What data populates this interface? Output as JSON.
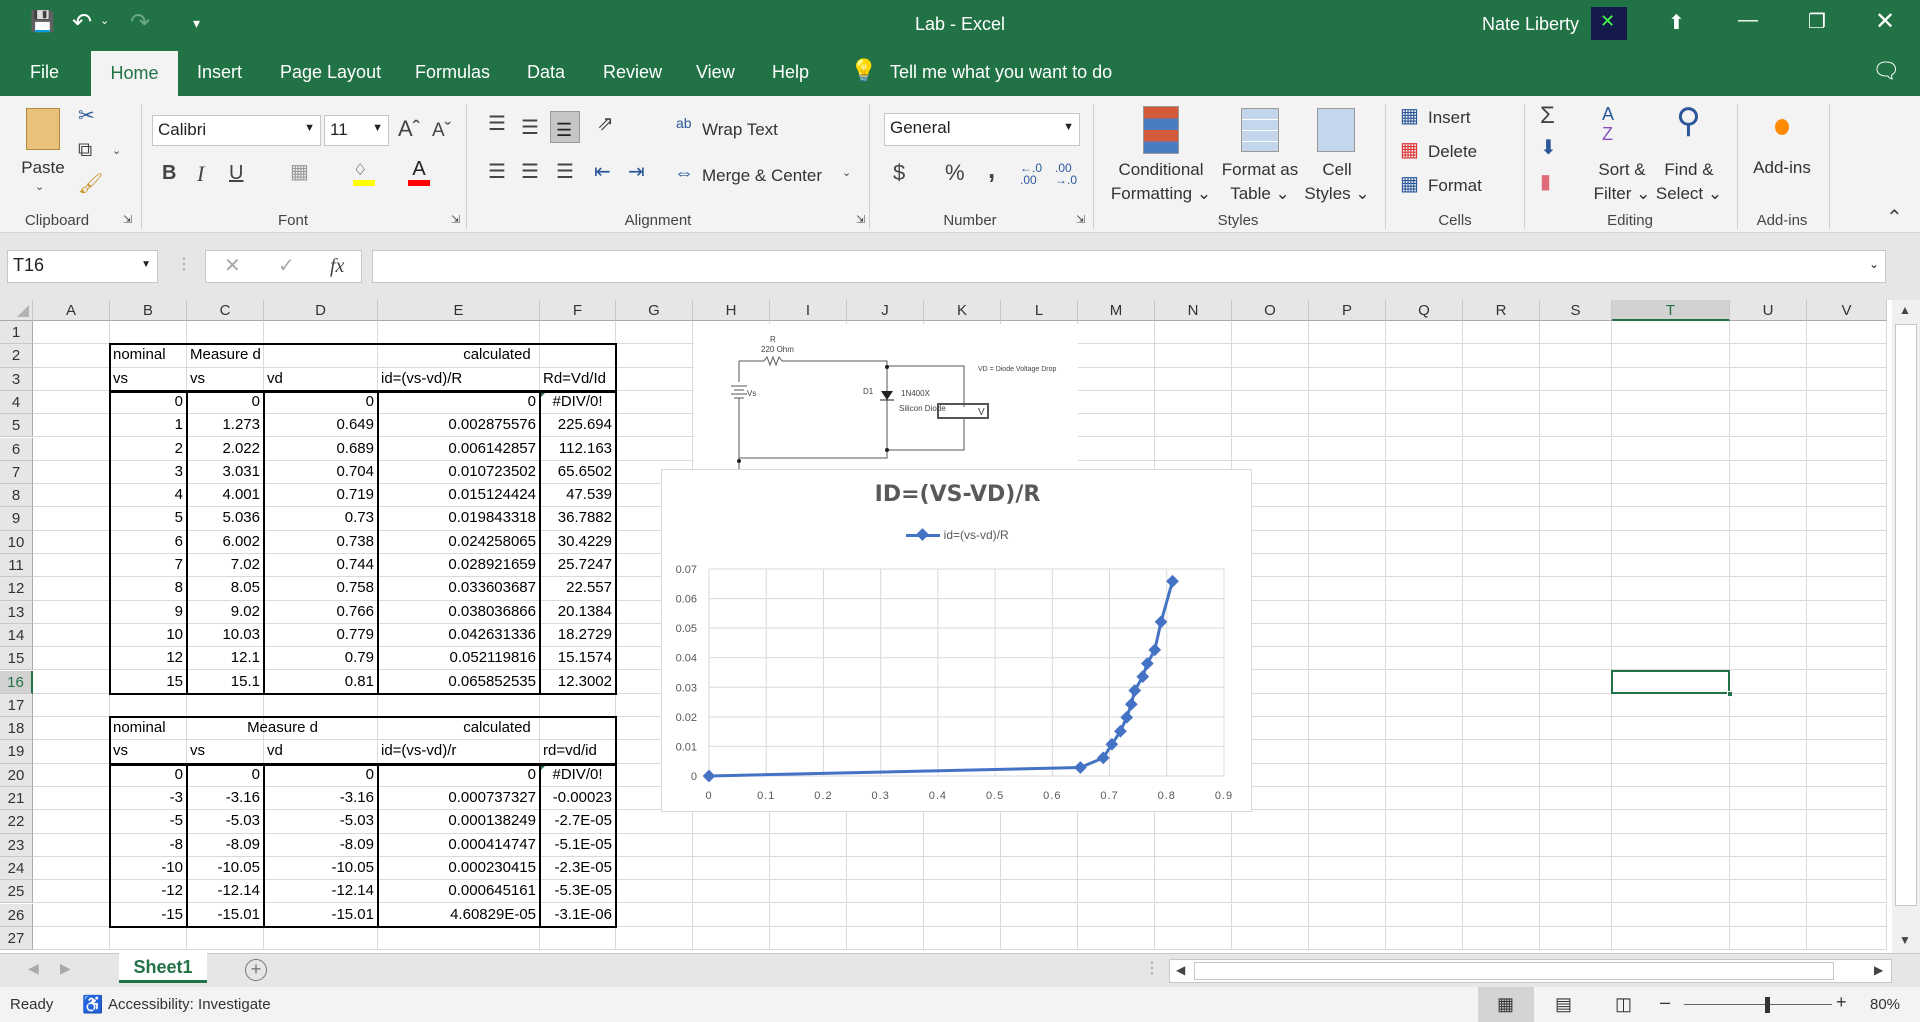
{
  "titlebar": {
    "title": "Lab  -  Excel",
    "user": "Nate Liberty"
  },
  "tabs": [
    "File",
    "Home",
    "Insert",
    "Page Layout",
    "Formulas",
    "Data",
    "Review",
    "View",
    "Help"
  ],
  "tell_me": "Tell me what you want to do",
  "ribbon": {
    "clipboard": {
      "label": "Clipboard",
      "paste": "Paste"
    },
    "font": {
      "label": "Font",
      "name": "Calibri",
      "size": "11",
      "bold": "B",
      "italic": "I",
      "underline": "U"
    },
    "alignment": {
      "label": "Alignment",
      "wrap": "Wrap Text",
      "merge": "Merge & Center"
    },
    "number": {
      "label": "Number",
      "format": "General",
      "currency": "$",
      "percent": "%",
      "comma": ","
    },
    "styles": {
      "label": "Styles",
      "conditional": [
        "Conditional",
        "Formatting"
      ],
      "format_table": [
        "Format as",
        "Table"
      ],
      "cell_styles": [
        "Cell",
        "Styles"
      ]
    },
    "cells": {
      "label": "Cells",
      "insert": "Insert",
      "delete": "Delete",
      "format": "Format"
    },
    "editing": {
      "label": "Editing",
      "sort": [
        "Sort &",
        "Filter"
      ],
      "find": [
        "Find &",
        "Select"
      ]
    },
    "addins": {
      "label": "Add-ins",
      "button": "Add-ins"
    }
  },
  "formula_bar": {
    "name_box": "T16",
    "formula": "",
    "fx": "fx"
  },
  "columns": [
    "A",
    "B",
    "C",
    "D",
    "E",
    "F",
    "G",
    "H",
    "I",
    "J",
    "K",
    "L",
    "M",
    "N",
    "O",
    "P",
    "Q",
    "R",
    "S",
    "T",
    "U",
    "V"
  ],
  "selected_cell": "T16",
  "rows": [
    {
      "r": 2,
      "cells": {
        "B": "nominal",
        "C": "Measure d",
        "E": "calculated"
      }
    },
    {
      "r": 3,
      "cells": {
        "B": "vs",
        "C": "vs",
        "D": "vd",
        "E": "id=(vs-vd)/R",
        "F": "Rd=Vd/Id"
      }
    },
    {
      "r": 4,
      "cells": {
        "B": "0",
        "C": "0",
        "D": "0",
        "E": "0",
        "F": "#DIV/0!"
      }
    },
    {
      "r": 5,
      "cells": {
        "B": "1",
        "C": "1.273",
        "D": "0.649",
        "E": "0.002875576",
        "F": "225.694"
      }
    },
    {
      "r": 6,
      "cells": {
        "B": "2",
        "C": "2.022",
        "D": "0.689",
        "E": "0.006142857",
        "F": "112.163"
      }
    },
    {
      "r": 7,
      "cells": {
        "B": "3",
        "C": "3.031",
        "D": "0.704",
        "E": "0.010723502",
        "F": "65.6502"
      }
    },
    {
      "r": 8,
      "cells": {
        "B": "4",
        "C": "4.001",
        "D": "0.719",
        "E": "0.015124424",
        "F": "47.539"
      }
    },
    {
      "r": 9,
      "cells": {
        "B": "5",
        "C": "5.036",
        "D": "0.73",
        "E": "0.019843318",
        "F": "36.7882"
      }
    },
    {
      "r": 10,
      "cells": {
        "B": "6",
        "C": "6.002",
        "D": "0.738",
        "E": "0.024258065",
        "F": "30.4229"
      }
    },
    {
      "r": 11,
      "cells": {
        "B": "7",
        "C": "7.02",
        "D": "0.744",
        "E": "0.028921659",
        "F": "25.7247"
      }
    },
    {
      "r": 12,
      "cells": {
        "B": "8",
        "C": "8.05",
        "D": "0.758",
        "E": "0.033603687",
        "F": "22.557"
      }
    },
    {
      "r": 13,
      "cells": {
        "B": "9",
        "C": "9.02",
        "D": "0.766",
        "E": "0.038036866",
        "F": "20.1384"
      }
    },
    {
      "r": 14,
      "cells": {
        "B": "10",
        "C": "10.03",
        "D": "0.779",
        "E": "0.042631336",
        "F": "18.2729"
      }
    },
    {
      "r": 15,
      "cells": {
        "B": "12",
        "C": "12.1",
        "D": "0.79",
        "E": "0.052119816",
        "F": "15.1574"
      }
    },
    {
      "r": 16,
      "cells": {
        "B": "15",
        "C": "15.1",
        "D": "0.81",
        "E": "0.065852535",
        "F": "12.3002"
      }
    },
    {
      "r": 18,
      "cells": {
        "B": "nominal",
        "C": "Measure d",
        "E": "calculated"
      }
    },
    {
      "r": 19,
      "cells": {
        "B": "vs",
        "C": "vs",
        "D": "vd",
        "E": "id=(vs-vd)/r",
        "F": "rd=vd/id"
      }
    },
    {
      "r": 20,
      "cells": {
        "B": "0",
        "C": "0",
        "D": "0",
        "E": "0",
        "F": "#DIV/0!"
      }
    },
    {
      "r": 21,
      "cells": {
        "B": "-3",
        "C": "-3.16",
        "D": "-3.16",
        "E": "0.000737327",
        "F": "-0.00023"
      }
    },
    {
      "r": 22,
      "cells": {
        "B": "-5",
        "C": "-5.03",
        "D": "-5.03",
        "E": "0.000138249",
        "F": "-2.7E-05"
      }
    },
    {
      "r": 23,
      "cells": {
        "B": "-8",
        "C": "-8.09",
        "D": "-8.09",
        "E": "0.000414747",
        "F": "-5.1E-05"
      }
    },
    {
      "r": 24,
      "cells": {
        "B": "-10",
        "C": "-10.05",
        "D": "-10.05",
        "E": "0.000230415",
        "F": "-2.3E-05"
      }
    },
    {
      "r": 25,
      "cells": {
        "B": "-12",
        "C": "-12.14",
        "D": "-12.14",
        "E": "0.000645161",
        "F": "-5.3E-05"
      }
    },
    {
      "r": 26,
      "cells": {
        "B": "-15",
        "C": "-15.01",
        "D": "-15.01",
        "E": "4.60829E-05",
        "F": "-3.1E-06"
      }
    }
  ],
  "circuit": {
    "r_label": "R",
    "r_value": "220  Ohm",
    "vs": "Vs",
    "d1": "D1",
    "diode": "1N400X",
    "diode_type": "Silicon Diode",
    "meter": "V",
    "note": "VD = Diode Voltage Drop"
  },
  "chart_data": {
    "type": "scatter",
    "title": "ID=(VS-VD)/R",
    "series": [
      {
        "name": "id=(vs-vd)/R",
        "color": "#4472c4",
        "x": [
          0,
          0.649,
          0.689,
          0.704,
          0.719,
          0.73,
          0.738,
          0.744,
          0.758,
          0.766,
          0.779,
          0.79,
          0.81
        ],
        "y": [
          0,
          0.002875576,
          0.006142857,
          0.010723502,
          0.015124424,
          0.019843318,
          0.024258065,
          0.028921659,
          0.033603687,
          0.038036866,
          0.042631336,
          0.052119816,
          0.065852535
        ]
      }
    ],
    "xlim": [
      0,
      0.9
    ],
    "ylim": [
      0,
      0.07
    ],
    "xticks": [
      "0",
      "0.1",
      "0.2",
      "0.3",
      "0.4",
      "0.5",
      "0.6",
      "0.7",
      "0.8",
      "0.9"
    ],
    "yticks": [
      "0",
      "0.01",
      "0.02",
      "0.03",
      "0.04",
      "0.05",
      "0.06",
      "0.07"
    ],
    "grid": true,
    "legend": "top",
    "marker": "diamond"
  },
  "sheets": [
    "Sheet1"
  ],
  "status": {
    "ready": "Ready",
    "accessibility": "Accessibility: Investigate",
    "zoom": "80%",
    "zoom_value": 80
  },
  "colors": {
    "accent": "#217346",
    "series": "#4472c4"
  }
}
